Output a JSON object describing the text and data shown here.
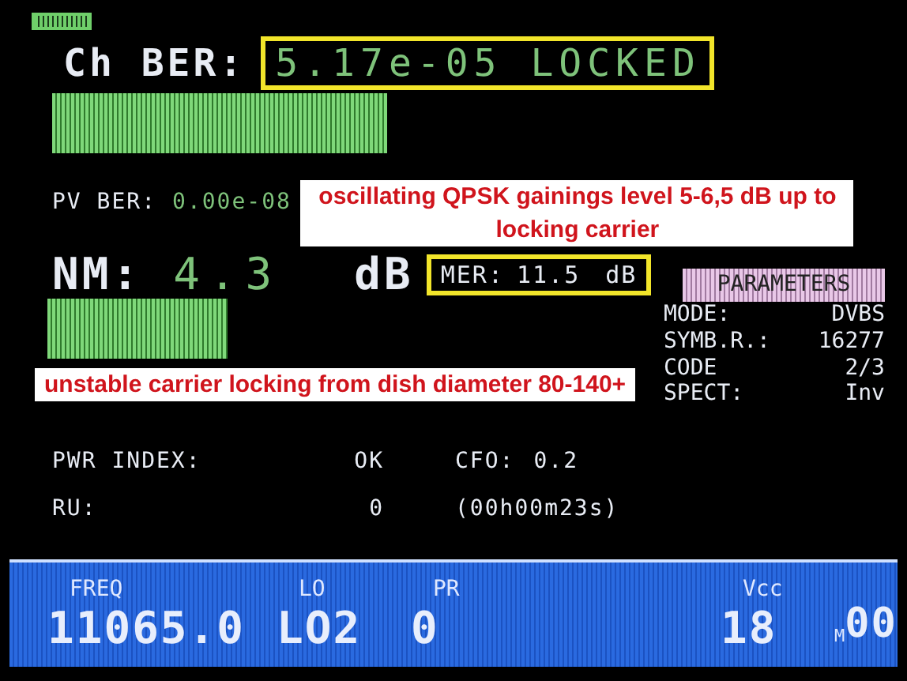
{
  "ch_ber": {
    "label": "Ch BER:",
    "value": "5.17e-05 LOCKED"
  },
  "pv_ber": {
    "label": "PV BER:",
    "value": "0.00e-08"
  },
  "annotations": [
    {
      "text": "oscillating QPSK gainings level 5-6,5 dB up to locking carrier"
    },
    {
      "text": "unstable carrier locking from dish diameter 80-140+"
    }
  ],
  "nm": {
    "label": "NM:",
    "value": "4.3",
    "unit": "dB"
  },
  "mer": {
    "label": "MER:",
    "value": "11.5",
    "unit": "dB"
  },
  "parameters": {
    "title": "PARAMETERS",
    "rows": [
      {
        "label": "MODE:",
        "value": "DVBS"
      },
      {
        "label": "SYMB.R.:",
        "value": "16277"
      },
      {
        "label": "CODE",
        "value": "2/3"
      },
      {
        "label": "SPECT:",
        "value": "Inv"
      }
    ]
  },
  "status_rows": [
    {
      "label": "PWR INDEX:",
      "value": "OK",
      "extra_label": "CFO:",
      "extra_value": "0.2"
    },
    {
      "label": "RU:",
      "value": "0",
      "extra_value": "(00h00m23s)"
    }
  ],
  "footer": {
    "freq_label": "FREQ",
    "freq": "11065.0",
    "lo_label": "LO",
    "lo": "LO2",
    "pr_label": "PR",
    "pr": "0",
    "vcc_label": "Vcc",
    "vcc": "18",
    "m_label": "M",
    "m": "00"
  }
}
